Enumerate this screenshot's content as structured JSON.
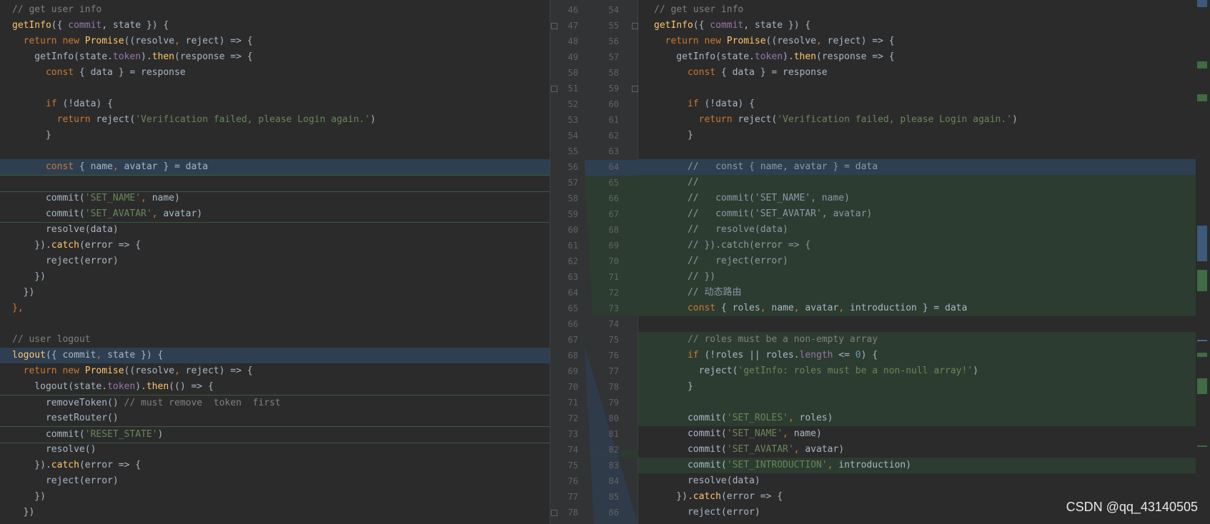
{
  "left": {
    "lines": [
      [
        [
          "// get user info",
          "c"
        ]
      ],
      [
        [
          "getInfo",
          "f"
        ],
        [
          "({ ",
          ""
        ],
        [
          "commit",
          "p"
        ],
        [
          ", state }) {",
          ""
        ]
      ],
      [
        [
          "  return new ",
          "k"
        ],
        [
          "Promise",
          "f"
        ],
        [
          "((resolve",
          ""
        ],
        [
          ", ",
          "k"
        ],
        [
          "reject) => {",
          ""
        ]
      ],
      [
        [
          "    getInfo(state.",
          ""
        ],
        [
          "token",
          "p"
        ],
        [
          ").",
          ""
        ],
        [
          "then",
          "f"
        ],
        [
          "(response => {",
          ""
        ]
      ],
      [
        [
          "      const ",
          "k"
        ],
        [
          "{ data } = response",
          ""
        ]
      ],
      [
        [
          "",
          ""
        ]
      ],
      [
        [
          "      if ",
          "k"
        ],
        [
          "(!data) {",
          ""
        ]
      ],
      [
        [
          "        return ",
          "k"
        ],
        [
          "reject(",
          ""
        ],
        [
          "'Verification failed, please Login again.'",
          "s"
        ],
        [
          ")",
          ""
        ]
      ],
      [
        [
          "      }",
          ""
        ]
      ],
      [
        [
          "",
          ""
        ]
      ],
      [
        [
          "      const ",
          "k"
        ],
        [
          "{ name",
          ""
        ],
        [
          ", ",
          "k"
        ],
        [
          "avatar } = data",
          ""
        ]
      ],
      [
        [
          "",
          ""
        ]
      ],
      [
        [
          "      commit(",
          ""
        ],
        [
          "'SET_NAME'",
          "s"
        ],
        [
          ", ",
          "k"
        ],
        [
          "name)",
          ""
        ]
      ],
      [
        [
          "      commit(",
          ""
        ],
        [
          "'SET_AVATAR'",
          "s"
        ],
        [
          ", ",
          "k"
        ],
        [
          "avatar)",
          ""
        ]
      ],
      [
        [
          "      resolve(data)",
          ""
        ]
      ],
      [
        [
          "    }).",
          ""
        ],
        [
          "catch",
          "f"
        ],
        [
          "(error => {",
          ""
        ]
      ],
      [
        [
          "      reject(error)",
          ""
        ]
      ],
      [
        [
          "    })",
          ""
        ]
      ],
      [
        [
          "  })",
          ""
        ]
      ],
      [
        [
          "},",
          "k"
        ]
      ],
      [
        [
          "",
          ""
        ]
      ],
      [
        [
          "// user logout",
          "c"
        ]
      ],
      [
        [
          "logout",
          "f"
        ],
        [
          "({ commit",
          ""
        ],
        [
          ", ",
          "k"
        ],
        [
          "state }) {",
          ""
        ]
      ],
      [
        [
          "  return new ",
          "k"
        ],
        [
          "Promise",
          "f"
        ],
        [
          "((resolve",
          ""
        ],
        [
          ", ",
          "k"
        ],
        [
          "reject) => {",
          ""
        ]
      ],
      [
        [
          "    logout(state.",
          ""
        ],
        [
          "token",
          "p"
        ],
        [
          ").",
          ""
        ],
        [
          "then",
          "f"
        ],
        [
          "(() => {",
          ""
        ]
      ],
      [
        [
          "      removeToken() ",
          ""
        ],
        [
          "// must remove  token  first",
          "c"
        ]
      ],
      [
        [
          "      resetRouter()",
          ""
        ]
      ],
      [
        [
          "      commit(",
          ""
        ],
        [
          "'RESET_STATE'",
          "s"
        ],
        [
          ")",
          ""
        ]
      ],
      [
        [
          "      resolve()",
          ""
        ]
      ],
      [
        [
          "    }).",
          ""
        ],
        [
          "catch",
          "f"
        ],
        [
          "(error => {",
          ""
        ]
      ],
      [
        [
          "      reject(error)",
          ""
        ]
      ],
      [
        [
          "    })",
          ""
        ]
      ],
      [
        [
          "  })",
          ""
        ]
      ]
    ],
    "numbers": [
      "46",
      "47",
      "48",
      "49",
      "50",
      "51",
      "52",
      "53",
      "54",
      "55",
      "56",
      "57",
      "58",
      "59",
      "60",
      "61",
      "62",
      "63",
      "64",
      "65",
      "66",
      "67",
      "68",
      "69",
      "70",
      "71",
      "72",
      "73",
      "74",
      "75",
      "76",
      "77",
      "78"
    ]
  },
  "right": {
    "lines": [
      [
        [
          "// get user info",
          "c"
        ]
      ],
      [
        [
          "getInfo",
          "f"
        ],
        [
          "({ ",
          ""
        ],
        [
          "commit",
          "p"
        ],
        [
          ", state }) {",
          ""
        ]
      ],
      [
        [
          "  return new ",
          "k"
        ],
        [
          "Promise",
          "f"
        ],
        [
          "((resolve",
          ""
        ],
        [
          ", ",
          "k"
        ],
        [
          "reject) => {",
          ""
        ]
      ],
      [
        [
          "    getInfo(state.",
          ""
        ],
        [
          "token",
          "p"
        ],
        [
          ").",
          ""
        ],
        [
          "then",
          "f"
        ],
        [
          "(response => {",
          ""
        ]
      ],
      [
        [
          "      const ",
          "k"
        ],
        [
          "{ data } = response",
          ""
        ]
      ],
      [
        [
          "",
          ""
        ]
      ],
      [
        [
          "      if ",
          "k"
        ],
        [
          "(!data) {",
          ""
        ]
      ],
      [
        [
          "        return ",
          "k"
        ],
        [
          "reject(",
          ""
        ],
        [
          "'Verification failed, please Login again.'",
          "s"
        ],
        [
          ")",
          ""
        ]
      ],
      [
        [
          "      }",
          ""
        ]
      ],
      [
        [
          "",
          ""
        ]
      ],
      [
        [
          "      //   const { name, avatar } = data",
          "cm"
        ]
      ],
      [
        [
          "      //",
          "cm"
        ]
      ],
      [
        [
          "      //   commit('SET_NAME', name)",
          "cm"
        ]
      ],
      [
        [
          "      //   commit('SET_AVATAR', avatar)",
          "cm"
        ]
      ],
      [
        [
          "      //   resolve(data)",
          "cm"
        ]
      ],
      [
        [
          "      // }).catch(error => {",
          "cm"
        ]
      ],
      [
        [
          "      //   reject(error)",
          "cm"
        ]
      ],
      [
        [
          "      // })",
          "cm"
        ]
      ],
      [
        [
          "      // 动态路由",
          "cm"
        ]
      ],
      [
        [
          "      const ",
          "k"
        ],
        [
          "{ roles",
          ""
        ],
        [
          ", ",
          "k"
        ],
        [
          "name",
          ""
        ],
        [
          ", ",
          "k"
        ],
        [
          "avatar",
          ""
        ],
        [
          ", ",
          "k"
        ],
        [
          "introduction } = data",
          ""
        ]
      ],
      [
        [
          "",
          ""
        ]
      ],
      [
        [
          "      // roles must be a non-empty array",
          "c"
        ]
      ],
      [
        [
          "      if ",
          "k"
        ],
        [
          "(!roles || roles.",
          ""
        ],
        [
          "length",
          "p"
        ],
        [
          " <= ",
          ""
        ],
        [
          "0",
          "n"
        ],
        [
          ") {",
          ""
        ]
      ],
      [
        [
          "        reject(",
          ""
        ],
        [
          "'getInfo: roles must be a non-null array!'",
          "s"
        ],
        [
          ")",
          ""
        ]
      ],
      [
        [
          "      }",
          ""
        ]
      ],
      [
        [
          "",
          ""
        ]
      ],
      [
        [
          "      commit(",
          ""
        ],
        [
          "'SET_ROLES'",
          "s"
        ],
        [
          ", ",
          "k"
        ],
        [
          "roles)",
          ""
        ]
      ],
      [
        [
          "      commit(",
          ""
        ],
        [
          "'SET_NAME'",
          "s"
        ],
        [
          ", ",
          "k"
        ],
        [
          "name)",
          ""
        ]
      ],
      [
        [
          "      commit(",
          ""
        ],
        [
          "'SET_AVATAR'",
          "s"
        ],
        [
          ", ",
          "k"
        ],
        [
          "avatar)",
          ""
        ]
      ],
      [
        [
          "      commit(",
          ""
        ],
        [
          "'SET_INTRODUCTION'",
          "s"
        ],
        [
          ", ",
          "k"
        ],
        [
          "introduction)",
          ""
        ]
      ],
      [
        [
          "      resolve(data)",
          ""
        ]
      ],
      [
        [
          "    }).",
          ""
        ],
        [
          "catch",
          "f"
        ],
        [
          "(error => {",
          ""
        ]
      ],
      [
        [
          "      reject(error)",
          ""
        ]
      ]
    ],
    "numbers": [
      "54",
      "55",
      "56",
      "57",
      "58",
      "59",
      "60",
      "61",
      "62",
      "63",
      "64",
      "65",
      "66",
      "67",
      "68",
      "69",
      "70",
      "71",
      "72",
      "73",
      "74",
      "75",
      "76",
      "77",
      "78",
      "79",
      "80",
      "81",
      "82",
      "83",
      "84",
      "85",
      "86"
    ]
  },
  "watermark": "CSDN @qq_43140505"
}
